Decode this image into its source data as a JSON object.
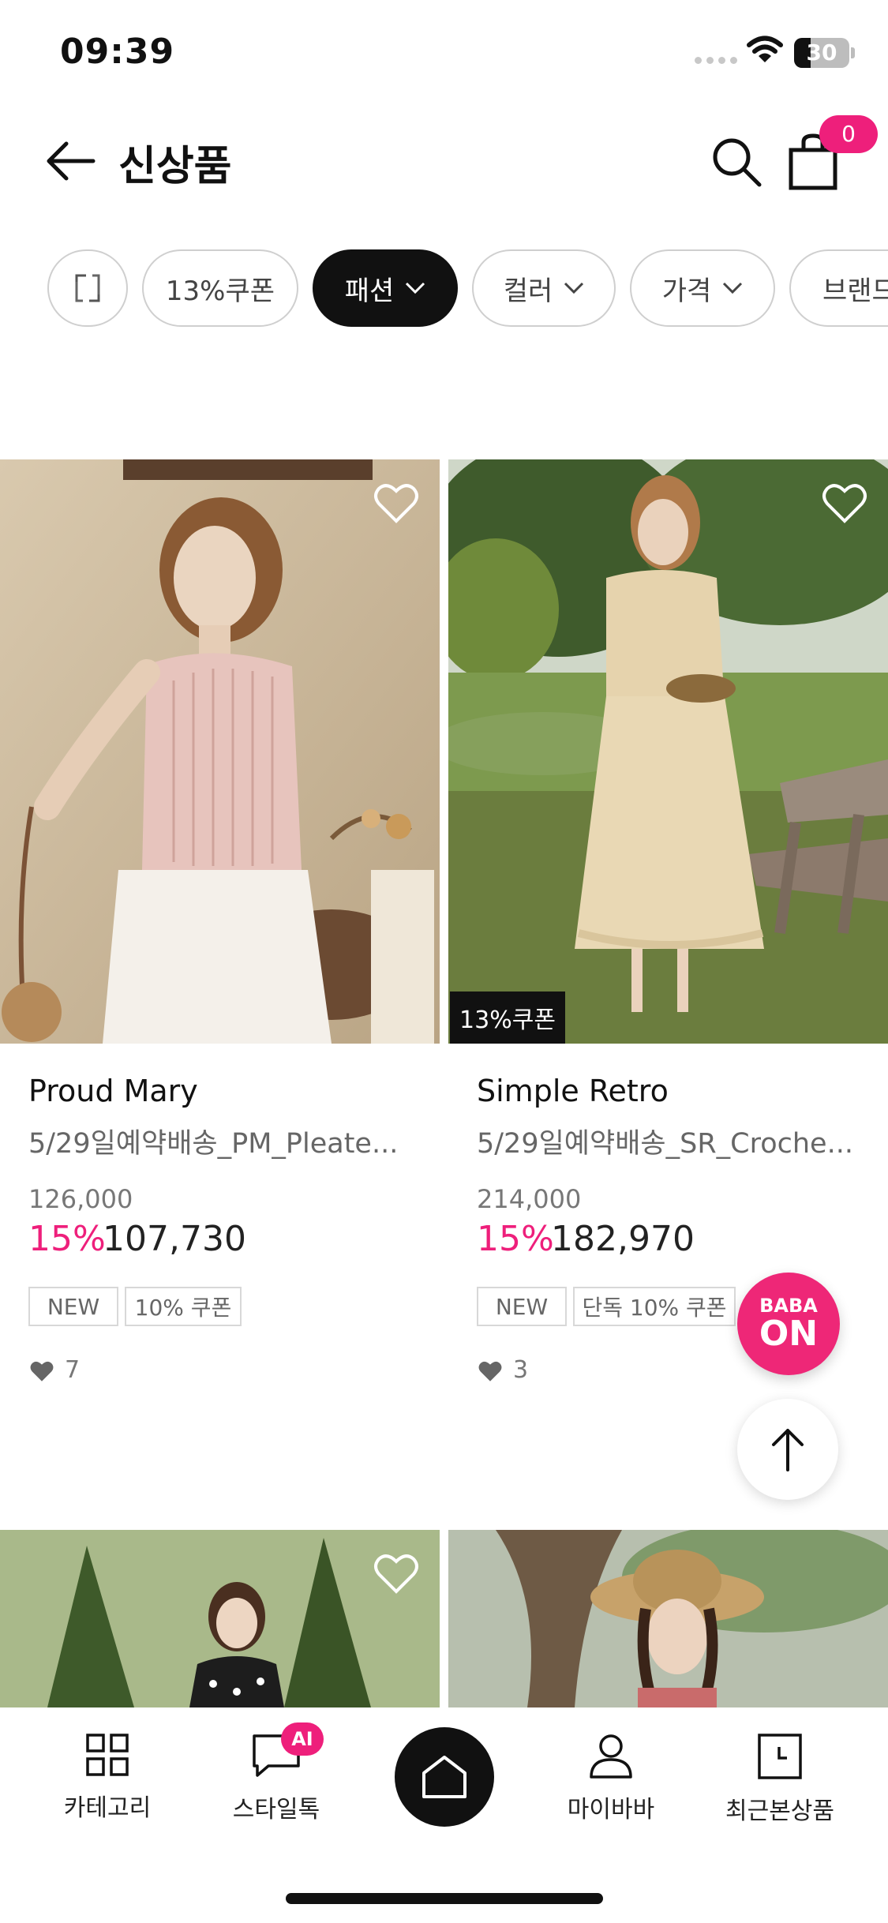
{
  "status_bar": {
    "time": "09:39",
    "battery": "30",
    "battery_level": 0.3
  },
  "header": {
    "title": "신상품",
    "cart_count": "0"
  },
  "filters": [
    {
      "label": "13%쿠폰",
      "active": false
    },
    {
      "label": "패션",
      "active": true
    },
    {
      "label": "컬러",
      "active": false
    },
    {
      "label": "가격",
      "active": false
    },
    {
      "label": "브랜드",
      "active": false
    }
  ],
  "products": [
    {
      "brand": "Proud Mary",
      "description": "5/29일예약배송_PM_Pleate...",
      "original_price": "126,000",
      "discount": "15%",
      "price": "107,730",
      "tags": [
        "NEW",
        "10% 쿠폰"
      ],
      "likes": "7",
      "image_badge": ""
    },
    {
      "brand": "Simple Retro",
      "description": "5/29일예약배송_SR_Croche...",
      "original_price": "214,000",
      "discount": "15%",
      "price": "182,970",
      "tags": [
        "NEW",
        "단독 10% 쿠폰"
      ],
      "likes": "3",
      "image_badge": "13%쿠폰"
    }
  ],
  "floating": {
    "babaon_line1": "BABA",
    "babaon_line2": "ON"
  },
  "bottom_nav": [
    {
      "label": "카테고리",
      "icon": "grid-icon"
    },
    {
      "label": "스타일톡",
      "icon": "chat-icon",
      "badge": "AI"
    },
    {
      "label": "",
      "icon": "home-icon"
    },
    {
      "label": "마이바바",
      "icon": "person-icon"
    },
    {
      "label": "최근본상품",
      "icon": "clock-icon"
    }
  ],
  "colors": {
    "accent": "#ee1f7b",
    "dark": "#111111"
  }
}
